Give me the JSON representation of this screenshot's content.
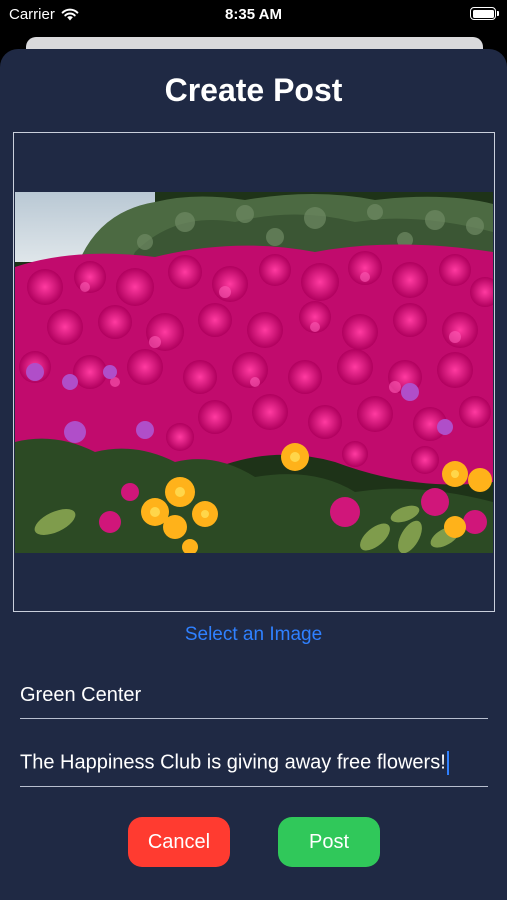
{
  "status_bar": {
    "carrier": "Carrier",
    "time": "8:35 AM"
  },
  "screen": {
    "title": "Create Post",
    "select_image_label": "Select an Image",
    "location_value": "Green Center",
    "description_value": "The Happiness Club is giving away free flowers!",
    "cancel_label": "Cancel",
    "post_label": "Post"
  },
  "image": {
    "content": "flower-field-photo"
  },
  "colors": {
    "sheet_background": "#1f2944",
    "link_blue": "#2f80ff",
    "cancel_red": "#ff3b30",
    "post_green": "#30c85a"
  }
}
